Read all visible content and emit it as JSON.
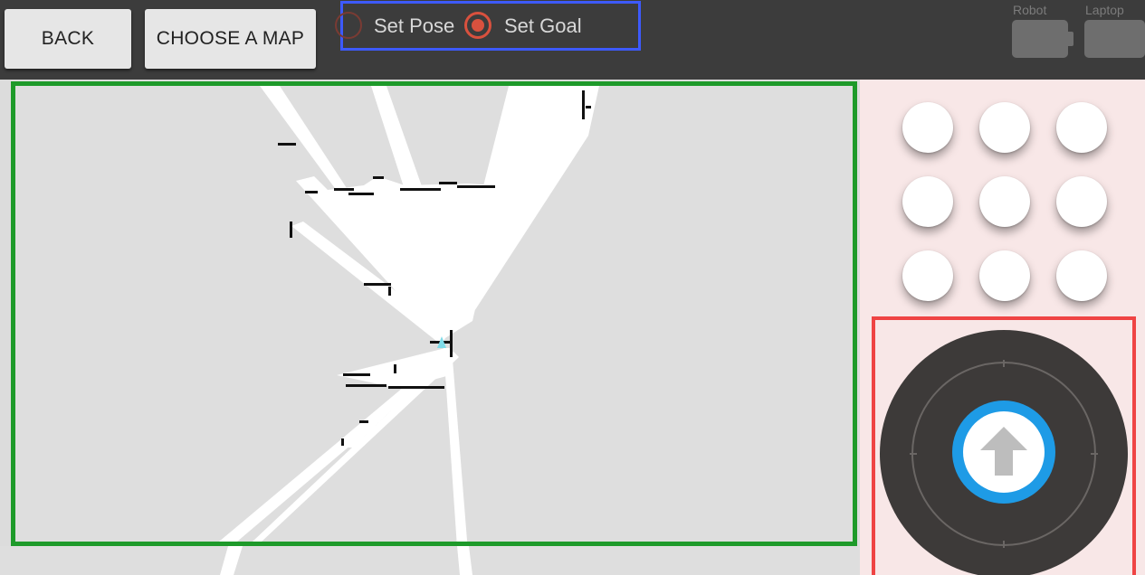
{
  "toolbar": {
    "back_label": "BACK",
    "choose_map_label": "CHOOSE A MAP"
  },
  "mode": {
    "set_pose_label": "Set Pose",
    "set_goal_label": "Set Goal",
    "selected": "Set Goal"
  },
  "status": {
    "robot_label": "Robot",
    "laptop_label": "Laptop"
  },
  "controls": {
    "grid_buttons": 9
  },
  "joystick": {
    "center_icon": "arrow-up-icon"
  },
  "colors": {
    "toolbar_bg": "#3c3c3c",
    "map_border": "#1e9a2a",
    "mode_border": "#3d5afe",
    "joystick_border": "#ef4444",
    "joystick_accent": "#1e9be6",
    "radio_accent": "#d9513e"
  }
}
